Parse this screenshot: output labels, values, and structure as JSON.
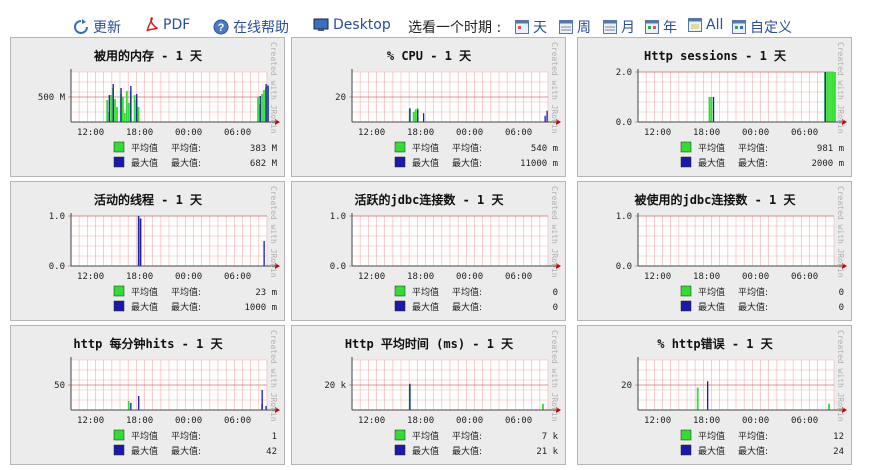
{
  "toolbar": {
    "refresh": "更新",
    "pdf": "PDF",
    "help": "在线帮助",
    "desktop": "Desktop",
    "period_label": "选看一个时期 :",
    "periods": [
      "天",
      "周",
      "月",
      "年",
      "All",
      "自定义"
    ]
  },
  "watermark": "Created with JRobin",
  "x_ticks": [
    "12:00",
    "18:00",
    "00:00",
    "06:00"
  ],
  "legend": {
    "avg_label": "平均值",
    "max_label": "最大值",
    "avg_prefix": "平均值:",
    "max_prefix": "最大值:"
  },
  "colors": {
    "avg": "#33dd33",
    "max": "#1a1aaa",
    "grid": "#f0b0b0",
    "arrow": "#cc0000"
  },
  "panels": [
    {
      "title": "被用的内存 - 1 天",
      "y_ticks": [
        "500 M"
      ],
      "avg": "383 M",
      "max": "682 M",
      "chart_data": {
        "type": "area",
        "ylim": [
          0,
          1000
        ],
        "y_label_values": [
          500
        ],
        "avg_bars": [
          [
            18,
            440
          ],
          [
            19,
            200
          ],
          [
            20,
            540
          ],
          [
            21,
            680
          ],
          [
            22,
            460
          ],
          [
            23,
            300
          ],
          [
            25,
            560
          ],
          [
            26,
            500
          ],
          [
            27,
            180
          ],
          [
            28,
            620
          ],
          [
            29,
            380
          ],
          [
            30,
            620
          ],
          [
            32,
            540
          ],
          [
            33,
            440
          ],
          [
            34,
            300
          ],
          [
            95,
            500
          ],
          [
            96,
            360
          ],
          [
            97,
            560
          ],
          [
            98,
            640
          ],
          [
            99,
            700
          ],
          [
            100,
            740
          ]
        ],
        "max_bars": [
          [
            19,
            540
          ],
          [
            21,
            760
          ],
          [
            25,
            680
          ],
          [
            30,
            720
          ],
          [
            33,
            560
          ],
          [
            96,
            520
          ],
          [
            99,
            760
          ],
          [
            100,
            720
          ]
        ]
      }
    },
    {
      "title": "% CPU - 1 天",
      "y_ticks": [
        "20"
      ],
      "avg": "540 m",
      "max": "11000 m",
      "chart_data": {
        "type": "area",
        "ylim": [
          0,
          40
        ],
        "y_label_values": [
          20
        ],
        "avg_bars": [
          [
            29,
            10
          ],
          [
            31,
            8
          ],
          [
            32,
            10
          ],
          [
            33,
            11
          ]
        ],
        "max_bars": [
          [
            29,
            11
          ],
          [
            33,
            10
          ],
          [
            36,
            7
          ],
          [
            98,
            5
          ],
          [
            99,
            9
          ]
        ]
      }
    },
    {
      "title": "Http sessions - 1 天",
      "y_ticks": [
        "2.0",
        "0.0"
      ],
      "avg": "981 m",
      "max": "2000 m",
      "chart_data": {
        "type": "area",
        "ylim": [
          0,
          2
        ],
        "y_label_values": [
          2.0,
          0.0
        ],
        "avg_bars": [
          [
            36,
            1
          ],
          [
            37,
            1
          ],
          [
            95,
            2
          ],
          [
            96,
            2
          ],
          [
            97,
            2
          ],
          [
            98,
            2
          ],
          [
            99,
            2
          ],
          [
            100,
            2
          ]
        ],
        "max_bars": [
          [
            38,
            1
          ],
          [
            95,
            2
          ]
        ]
      }
    },
    {
      "title": "活动的线程 - 1 天",
      "y_ticks": [
        "1.0",
        "0.0"
      ],
      "avg": "23 m",
      "max": "1000 m",
      "chart_data": {
        "type": "area",
        "ylim": [
          0,
          1
        ],
        "y_label_values": [
          1.0,
          0.0
        ],
        "avg_bars": [
          [
            34,
            1
          ],
          [
            35,
            0.95
          ]
        ],
        "max_bars": [
          [
            34,
            1
          ],
          [
            35,
            0.95
          ],
          [
            98,
            0.5
          ]
        ]
      }
    },
    {
      "title": "活跃的jdbc连接数 - 1 天",
      "y_ticks": [
        "1.0",
        "0.0"
      ],
      "avg": "0",
      "max": "0",
      "chart_data": {
        "type": "area",
        "ylim": [
          0,
          1
        ],
        "y_label_values": [
          1.0,
          0.0
        ],
        "avg_bars": [],
        "max_bars": []
      }
    },
    {
      "title": "被使用的jdbc连接数 - 1 天",
      "y_ticks": [
        "1.0",
        "0.0"
      ],
      "avg": "0",
      "max": "0",
      "chart_data": {
        "type": "area",
        "ylim": [
          0,
          1
        ],
        "y_label_values": [
          1.0,
          0.0
        ],
        "avg_bars": [],
        "max_bars": []
      }
    },
    {
      "title": "http 每分钟hits - 1 天",
      "y_ticks": [
        "50"
      ],
      "avg": "1",
      "max": "42",
      "chart_data": {
        "type": "area",
        "ylim": [
          0,
          100
        ],
        "y_label_values": [
          50
        ],
        "avg_bars": [
          [
            29,
            18
          ],
          [
            97,
            12
          ]
        ],
        "max_bars": [
          [
            30,
            14
          ],
          [
            34,
            28
          ],
          [
            97,
            40
          ],
          [
            99,
            8
          ]
        ]
      }
    },
    {
      "title": "Http 平均时间 (ms) - 1 天",
      "y_ticks": [
        "20 k"
      ],
      "avg": "7 k",
      "max": "21 k",
      "chart_data": {
        "type": "area",
        "ylim": [
          0,
          40000
        ],
        "y_label_values": [
          20000
        ],
        "avg_bars": [
          [
            28,
            500
          ],
          [
            29,
            20000
          ],
          [
            97,
            5000
          ]
        ],
        "max_bars": [
          [
            29,
            21000
          ]
        ]
      }
    },
    {
      "title": "% http错误 - 1 天",
      "y_ticks": [
        "20"
      ],
      "avg": "12",
      "max": "24",
      "chart_data": {
        "type": "area",
        "ylim": [
          0,
          40
        ],
        "y_label_values": [
          20
        ],
        "avg_bars": [
          [
            30,
            18
          ],
          [
            97,
            5
          ]
        ],
        "max_bars": [
          [
            35,
            23
          ]
        ]
      }
    }
  ]
}
